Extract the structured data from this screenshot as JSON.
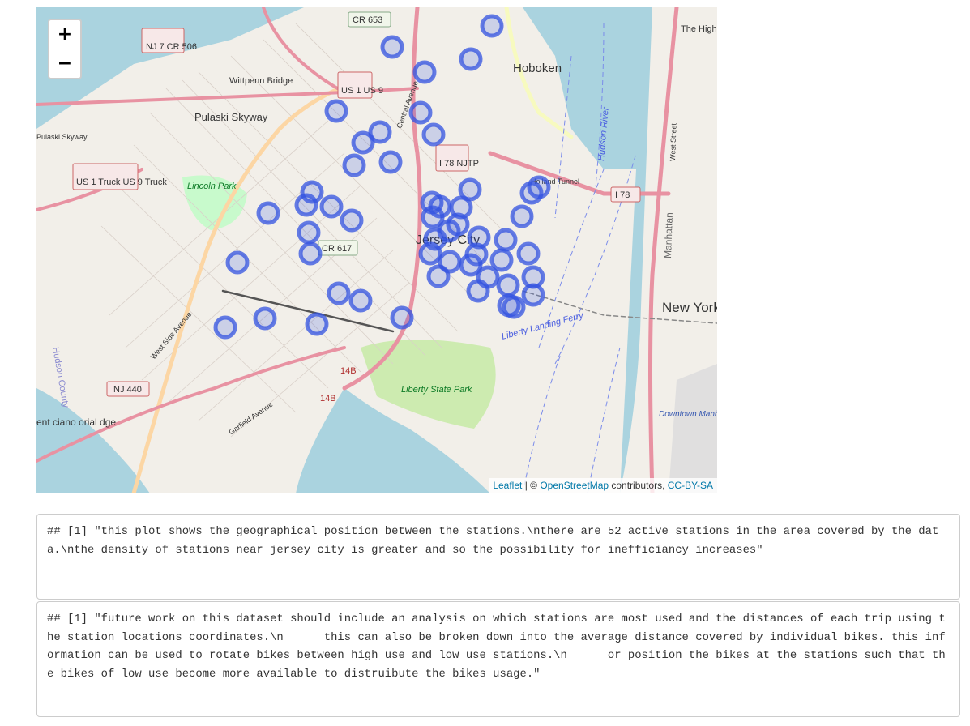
{
  "map": {
    "zoom_in_label": "+",
    "zoom_out_label": "−",
    "attribution": {
      "leaflet": "Leaflet",
      "separator": " | © ",
      "osm": "OpenStreetMap",
      "contributors": " contributors, ",
      "license": "CC-BY-SA"
    },
    "marker_color": "#3353e0",
    "station_count": 52,
    "labels": {
      "hoboken": "Hoboken",
      "jersey_city": "Jersey City",
      "new_york": "New York",
      "lincoln_park": "Lincoln Park",
      "liberty_state_park": "Liberty State Park",
      "pulaski_skyway": "Pulaski Skyway",
      "pulaski_skyway_road": "Pulaski Skyway",
      "wittpenn_bridge": "Wittpenn Bridge",
      "hudson_county": "Hudson County",
      "holland_tunnel": "Holland Tunnel",
      "downtown_heliport": "Downtown Manhattan Heliport",
      "liberty_landing_ferry": "Liberty Landing Ferry",
      "west_side_avenue": "West Side Avenue",
      "garfield_avenue": "Garfield Avenue",
      "central_avenue": "Central Avenue",
      "the_high_line": "The High Line",
      "manhattan": "Manhattan",
      "west_street": "West Street",
      "hudson_river": "Hudson River",
      "edge_text": "ent ciano orial dge"
    },
    "shields": {
      "nj7": "NJ 7 CR 506",
      "cr653": "CR 653",
      "us1us9": "US 1 US 9",
      "us1truck": "US 1 Truck US 9 Truck",
      "i78njtp": "I 78 NJTP",
      "i78": "I 78",
      "cr617": "CR 617",
      "nj440": "NJ 440",
      "14b_a": "14B",
      "14b_b": "14B"
    }
  },
  "outputs": [
    {
      "text": "## [1] \"this plot shows the geographical position between the stations.\\nthere are 52 active stations in the area covered by the data.\\nthe density of stations near jersey city is greater and so the possibility for inefficiancy increases\""
    },
    {
      "text": "## [1] \"future work on this dataset should include an analysis on which stations are most used and the distances of each trip using the station locations coordinates.\\n      this can also be broken down into the average distance covered by individual bikes. this information can be used to rotate bikes between high use and low use stations.\\n      or position the bikes at the stations such that the bikes of low use become more available to distruibute the bikes usage.\""
    }
  ]
}
